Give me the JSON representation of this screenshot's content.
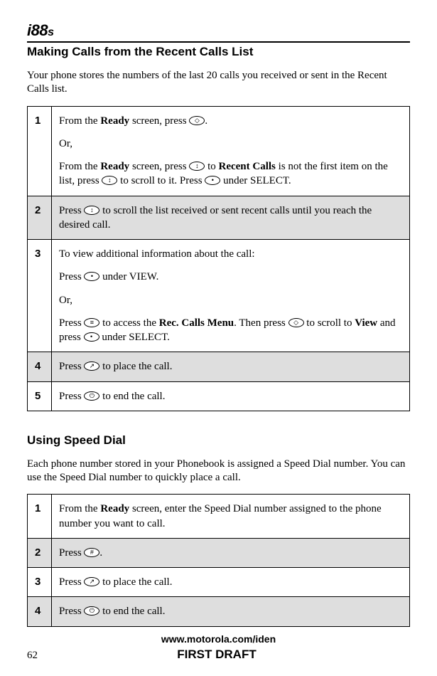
{
  "header": {
    "model": "i88",
    "model_suffix": "s"
  },
  "section1": {
    "title": "Making Calls from the Recent Calls List",
    "intro": "Your phone stores the numbers of the last 20 calls you received or sent in the Recent Calls list.",
    "steps": [
      {
        "num": "1",
        "shaded": false
      },
      {
        "num": "2",
        "shaded": true
      },
      {
        "num": "3",
        "shaded": false
      },
      {
        "num": "4",
        "shaded": true
      },
      {
        "num": "5",
        "shaded": false
      }
    ],
    "s1p1a": "From the ",
    "s1p1b": "Ready",
    "s1p1c": " screen, press ",
    "s1p1d": ".",
    "s1p2": "Or,",
    "s1p3a": "From the ",
    "s1p3b": "Ready",
    "s1p3c": " screen, press ",
    "s1p3d": " to ",
    "s1p3e": "Recent Calls",
    "s1p3f": " is not the first item on the list, press ",
    "s1p3g": " to scroll to it. Press ",
    "s1p3h": " under SELECT.",
    "s2a": "Press ",
    "s2b": " to scroll the list received or sent recent calls until you reach the desired call.",
    "s3p1": "To view additional information about the call:",
    "s3p2a": "Press ",
    "s3p2b": " under VIEW.",
    "s3p3": "Or,",
    "s3p4a": "Press ",
    "s3p4b": " to access the ",
    "s3p4c": "Rec. Calls Menu",
    "s3p4d": ". Then press ",
    "s3p4e": " to scroll to ",
    "s3p4f": "View",
    "s3p4g": " and press ",
    "s3p4h": " under SELECT.",
    "s4a": "Press ",
    "s4b": " to place the call.",
    "s5a": "Press ",
    "s5b": " to end the call."
  },
  "section2": {
    "title": "Using Speed Dial",
    "intro": "Each phone number stored in your Phonebook is assigned a Speed Dial number. You can use the Speed Dial number to quickly place a call.",
    "steps": [
      {
        "num": "1",
        "shaded": false
      },
      {
        "num": "2",
        "shaded": true
      },
      {
        "num": "3",
        "shaded": false
      },
      {
        "num": "4",
        "shaded": true
      }
    ],
    "t1a": "From the ",
    "t1b": "Ready",
    "t1c": " screen, enter the Speed Dial number assigned to the phone number you want to call.",
    "t2a": "Press ",
    "t2b": ".",
    "t3a": "Press ",
    "t3b": " to place the call.",
    "t4a": "Press ",
    "t4b": " to end the call."
  },
  "footer": {
    "url": "www.motorola.com/iden",
    "page": "62",
    "draft": "FIRST DRAFT"
  },
  "icons": {
    "nav": "◇",
    "scroll": "↕",
    "dot": "•",
    "menu": "≡",
    "call": "↗",
    "end": "⏻",
    "hash": "#"
  }
}
